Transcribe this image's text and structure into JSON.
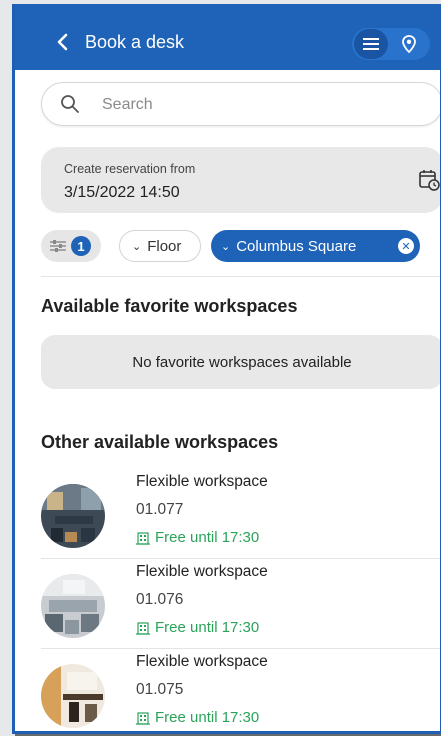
{
  "header": {
    "title": "Book a desk"
  },
  "search": {
    "placeholder": "Search"
  },
  "reservation": {
    "label": "Create reservation from",
    "value": "3/15/2022 14:50"
  },
  "filters": {
    "count": "1",
    "floor_label": "Floor",
    "location_label": "Columbus Square"
  },
  "favorites": {
    "title": "Available favorite workspaces",
    "empty_message": "No favorite workspaces available"
  },
  "other": {
    "title": "Other available workspaces",
    "items": [
      {
        "name": "Flexible workspace",
        "code": "01.077",
        "status": "Free until 17:30"
      },
      {
        "name": "Flexible workspace",
        "code": "01.076",
        "status": "Free until 17:30"
      },
      {
        "name": "Flexible workspace",
        "code": "01.075",
        "status": "Free until 17:30"
      }
    ]
  },
  "colors": {
    "primary": "#1e63b8",
    "free_green": "#2aa35a",
    "surface_gray": "#e8e8e8"
  }
}
